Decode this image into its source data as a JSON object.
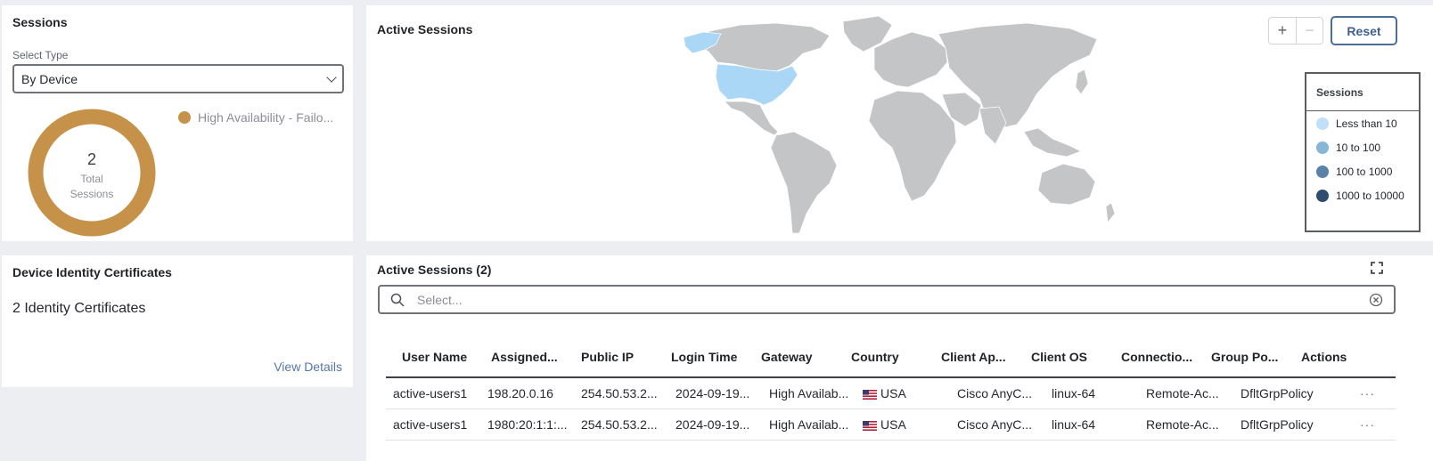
{
  "sessions_card": {
    "title": "Sessions",
    "select_label": "Select Type",
    "select_value": "By Device",
    "donut_value": "2",
    "donut_label_line1": "Total",
    "donut_label_line2": "Sessions",
    "legend_label": "High Availability - Failo...",
    "legend_color": "#c6924a"
  },
  "cert_card": {
    "title": "Device Identity Certificates",
    "count_text": "2 Identity Certificates",
    "link": "View Details"
  },
  "map_card": {
    "title": "Active Sessions",
    "zoom_in": "+",
    "zoom_out": "−",
    "reset": "Reset",
    "legend_title": "Sessions",
    "legend": [
      {
        "label": "Less than 10",
        "color": "#bfe0f8"
      },
      {
        "label": "10 to 100",
        "color": "#86b6d8"
      },
      {
        "label": "100 to 1000",
        "color": "#5a82a8"
      },
      {
        "label": "1000 to 10000",
        "color": "#2e4d6f"
      }
    ],
    "land_color": "#c4c5c7",
    "highlight_color": "#a9d7f5"
  },
  "table_card": {
    "title": "Active Sessions (2)",
    "search_placeholder": "Select...",
    "columns": [
      "User Name",
      "Assigned...",
      "Public IP",
      "Login Time",
      "Gateway",
      "Country",
      "Client Ap...",
      "Client OS",
      "Connectio...",
      "Group Po...",
      "Actions"
    ],
    "rows": [
      {
        "user": "active-users1",
        "assigned": "198.20.0.16",
        "public_ip": "254.50.53.2...",
        "login": "2024-09-19...",
        "gateway": "High Availab...",
        "country": "USA",
        "client_app": "Cisco AnyC...",
        "client_os": "linux-64",
        "connection": "Remote-Ac...",
        "group": "DfltGrpPolicy",
        "actions": "···"
      },
      {
        "user": "active-users1",
        "assigned": "1980:20:1:1:...",
        "public_ip": "254.50.53.2...",
        "login": "2024-09-19...",
        "gateway": "High Availab...",
        "country": "USA",
        "client_app": "Cisco AnyC...",
        "client_os": "linux-64",
        "connection": "Remote-Ac...",
        "group": "DfltGrpPolicy",
        "actions": "···"
      }
    ]
  }
}
